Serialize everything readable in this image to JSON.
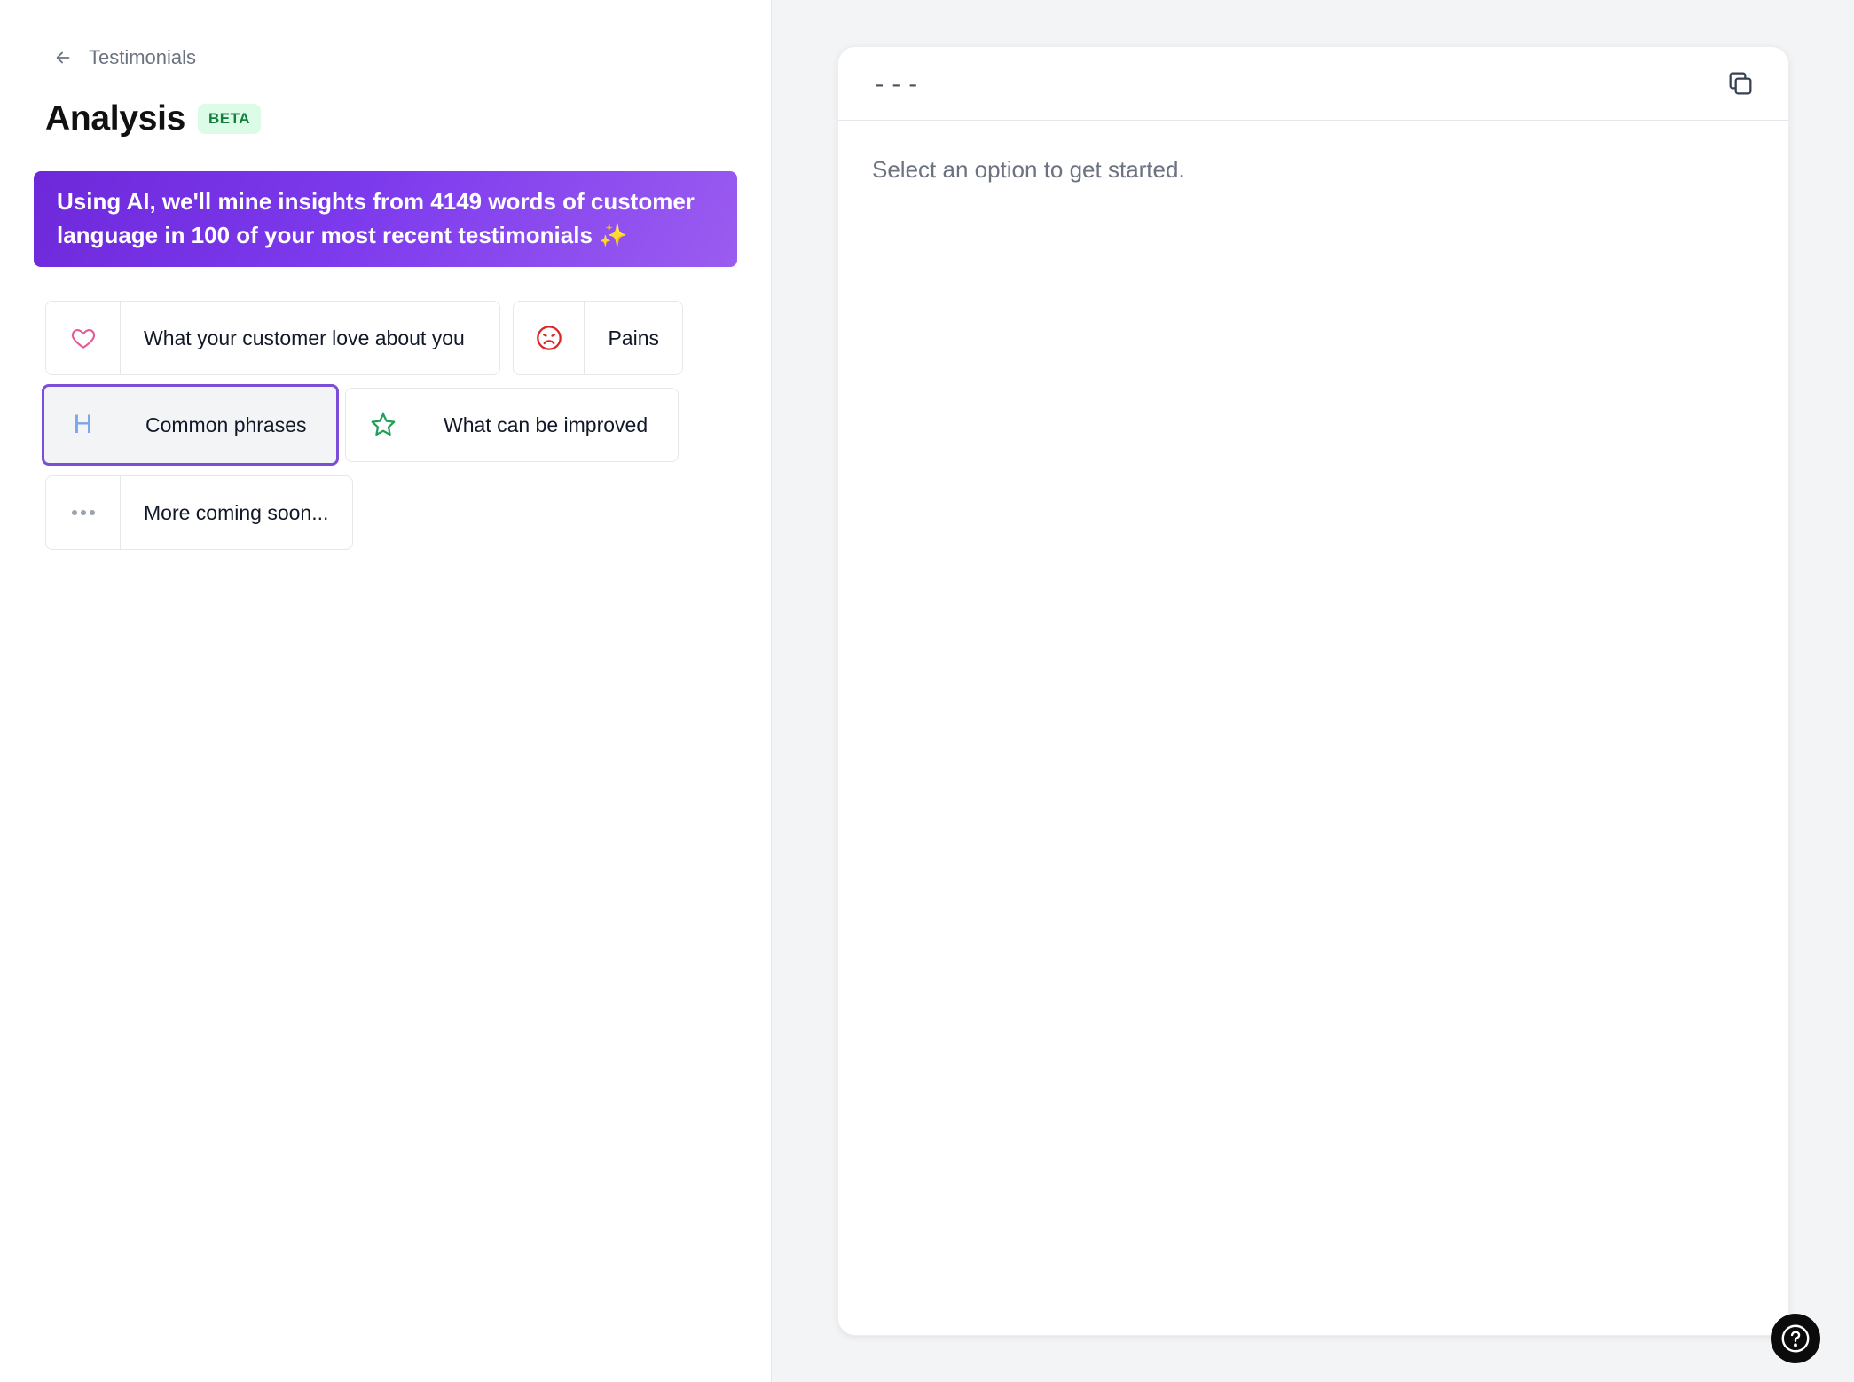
{
  "nav": {
    "back_label": "Testimonials"
  },
  "header": {
    "title": "Analysis",
    "badge": "BETA"
  },
  "banner": {
    "text": "Using AI, we'll mine insights from 4149 words of customer language in 100 of your most recent testimonials ✨"
  },
  "options": [
    {
      "label": "What your customer love about you",
      "icon": "heart-icon",
      "color": "#e15b97"
    },
    {
      "label": "Pains",
      "icon": "frown-icon",
      "color": "#dc2626"
    },
    {
      "label": "Common phrases",
      "icon": "H",
      "color": "#7da4e8",
      "selected": true
    },
    {
      "label": "What can be improved",
      "icon": "star-icon",
      "color": "#22a05b"
    },
    {
      "label": "More coming soon...",
      "icon": "more-dots-icon",
      "color": "#9ca3af"
    }
  ],
  "result": {
    "header_text": "---",
    "placeholder": "Select an option to get started."
  },
  "colors": {
    "accent": "#7c3aed",
    "badge_bg": "#dcfce7",
    "badge_text": "#15803d"
  }
}
